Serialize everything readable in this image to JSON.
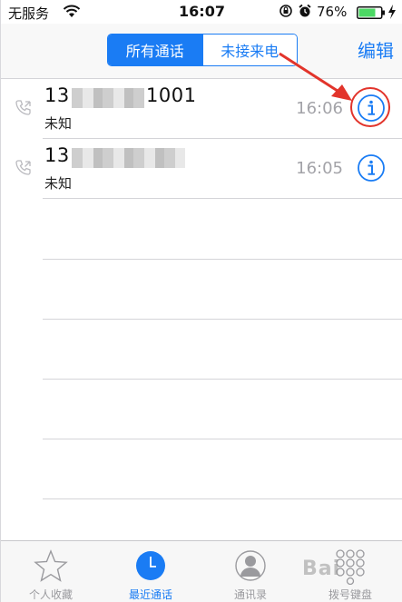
{
  "status_bar": {
    "carrier": "无服务",
    "time": "16:07",
    "battery": "76%"
  },
  "nav": {
    "segments": [
      "所有通话",
      "未接来电"
    ],
    "selected_segment": 0,
    "edit_label": "编辑"
  },
  "calls": [
    {
      "number_prefix": "13",
      "number_suffix": "1001",
      "label": "未知",
      "time": "16:06"
    },
    {
      "number_prefix": "13",
      "number_suffix": "",
      "label": "未知",
      "time": "16:05"
    }
  ],
  "tabs": [
    {
      "label": "个人收藏",
      "icon": "star-icon"
    },
    {
      "label": "最近通话",
      "icon": "clock-icon"
    },
    {
      "label": "通讯录",
      "icon": "contacts-icon"
    },
    {
      "label": "拨号键盘",
      "icon": "keypad-icon"
    }
  ],
  "active_tab": 1,
  "watermark": "Bai",
  "colors": {
    "accent": "#1a7cf4",
    "annotation": "#e2342b",
    "battery": "#4cd964"
  }
}
